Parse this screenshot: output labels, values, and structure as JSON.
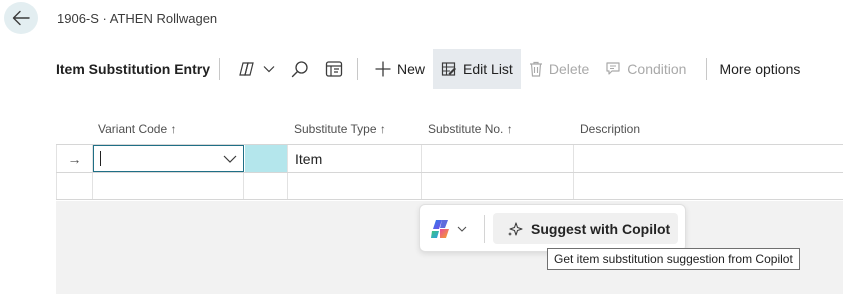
{
  "breadcrumb": "1906-S · ATHEN Rollwagen",
  "toolbar": {
    "title": "Item Substitution Entry",
    "new_label": "New",
    "edit_list_label": "Edit List",
    "delete_label": "Delete",
    "condition_label": "Condition",
    "more_options_label": "More options"
  },
  "grid": {
    "columns": {
      "variant_code": "Variant Code",
      "substitute_type": "Substitute Type",
      "substitute_no": "Substitute No.",
      "description": "Description"
    },
    "sort_indicator": "↑",
    "row_indicator": "→",
    "rows": [
      {
        "variant_code": "",
        "substitute_type": "Item",
        "substitute_no": "",
        "description": ""
      },
      {
        "variant_code": "",
        "substitute_type": "",
        "substitute_no": "",
        "description": ""
      }
    ]
  },
  "copilot": {
    "suggest_label": "Suggest with Copilot",
    "tooltip": "Get item substitution suggestion from Copilot"
  },
  "colors": {
    "accent": "#1f6f86",
    "selected_cell": "#b4e6ec",
    "back_button_bg": "#e3eef1"
  },
  "icons": {
    "back": "arrow-left-icon",
    "share": "share-icon",
    "search": "search-icon",
    "filter": "filter-pane-icon",
    "new": "plus-icon",
    "edit_list": "edit-list-icon",
    "delete": "trash-icon",
    "condition": "comment-icon",
    "copilot": "copilot-logo-icon",
    "sparkle": "sparkle-icon"
  }
}
